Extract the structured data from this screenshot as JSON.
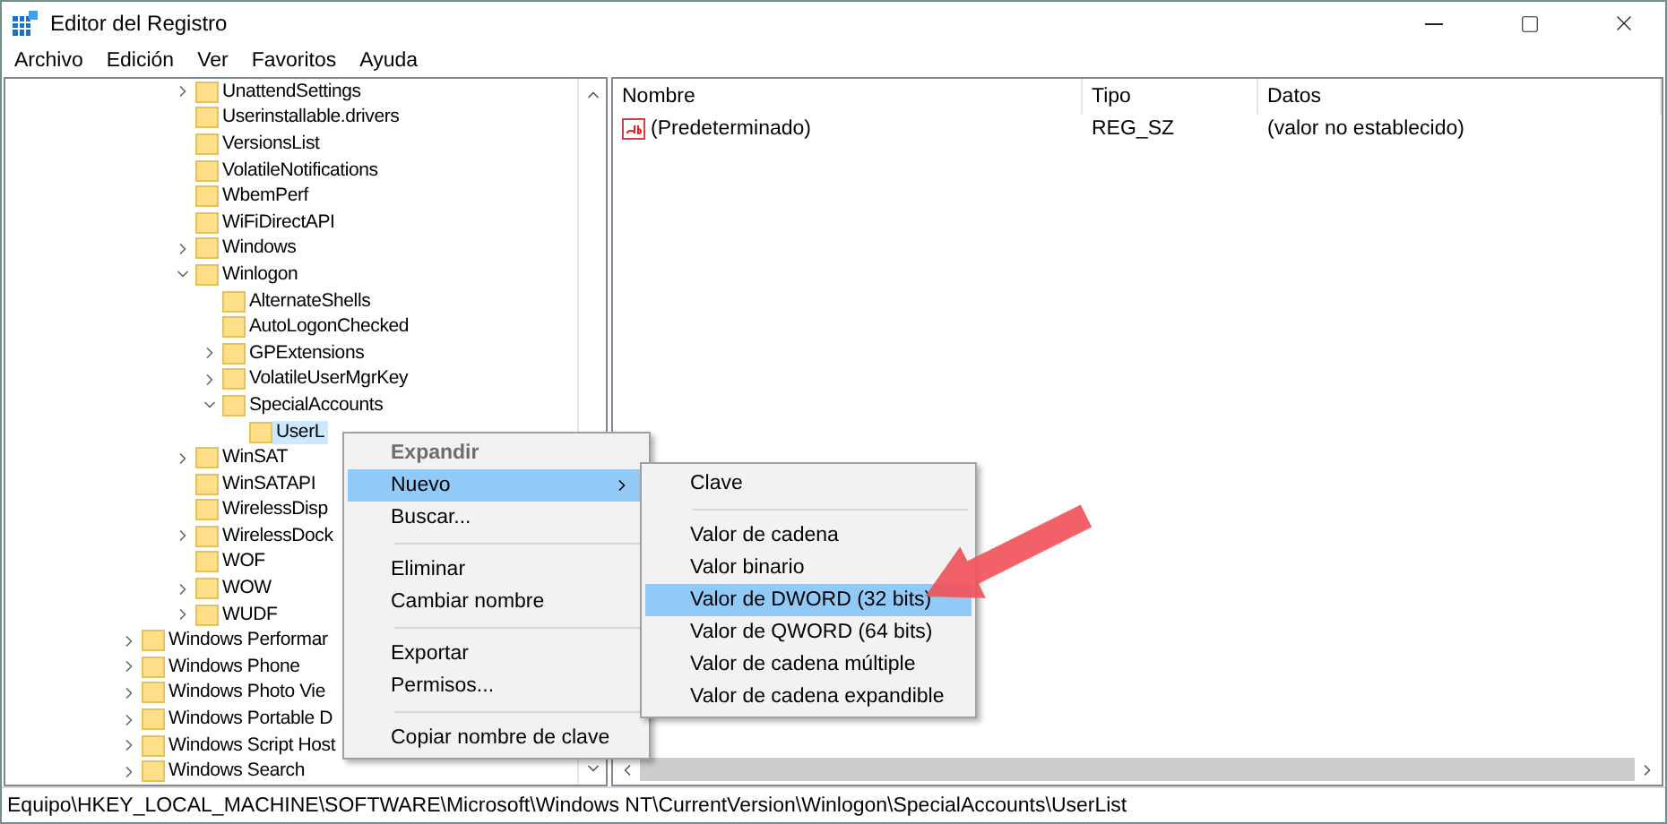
{
  "window": {
    "title": "Editor del Registro"
  },
  "menu_bar": [
    "Archivo",
    "Edición",
    "Ver",
    "Favoritos",
    "Ayuda"
  ],
  "tree": {
    "items": [
      {
        "children": [
          {
            "label": "UnattendSettings",
            "expanded": false,
            "selected": false
          },
          {
            "label": "Userinstallable.drivers",
            "selected": false
          },
          {
            "label": "VersionsList",
            "selected": false
          },
          {
            "label": "VolatileNotifications",
            "selected": false
          },
          {
            "label": "WbemPerf",
            "selected": false
          },
          {
            "label": "WiFiDirectAPI",
            "selected": false
          },
          {
            "label": "Windows",
            "expanded": false,
            "selected": false
          },
          {
            "label": "Winlogon",
            "expanded": true,
            "selected": false,
            "children": [
              {
                "label": "AlternateShells",
                "selected": false
              },
              {
                "label": "AutoLogonChecked",
                "selected": false
              },
              {
                "label": "GPExtensions",
                "expanded": false,
                "selected": false
              },
              {
                "label": "VolatileUserMgrKey",
                "expanded": false,
                "selected": false
              },
              {
                "label": "SpecialAccounts",
                "expanded": true,
                "selected": false,
                "children": [
                  {
                    "label": "UserL",
                    "selected": true
                  }
                ]
              }
            ]
          },
          {
            "label": "WinSAT",
            "expanded": false,
            "selected": false
          },
          {
            "label": "WinSATAPI",
            "selected": false
          },
          {
            "label": "WirelessDisp",
            "selected": false
          },
          {
            "label": "WirelessDock",
            "expanded": false,
            "selected": false
          },
          {
            "label": "WOF",
            "selected": false
          },
          {
            "label": "WOW",
            "expanded": false,
            "selected": false
          },
          {
            "label": "WUDF",
            "expanded": false,
            "selected": false
          }
        ]
      },
      {
        "label": "Windows Performar",
        "expanded": false,
        "selected": false
      },
      {
        "label": "Windows Phone",
        "expanded": false,
        "selected": false
      },
      {
        "label": "Windows Photo Vie",
        "expanded": false,
        "selected": false
      },
      {
        "label": "Windows Portable D",
        "expanded": false,
        "selected": false
      },
      {
        "label": "Windows Script Host",
        "expanded": false,
        "selected": false
      },
      {
        "label": "Windows Search",
        "expanded": false,
        "selected": false
      }
    ]
  },
  "values_list": {
    "columns": [
      "Nombre",
      "Tipo",
      "Datos"
    ],
    "rows": [
      {
        "name": "(Predeterminado)",
        "type": "REG_SZ",
        "data": "(valor no establecido)"
      }
    ]
  },
  "context_menu": {
    "items": [
      {
        "kind": "item",
        "label": "Expandir",
        "disabled": true,
        "selected": false
      },
      {
        "kind": "item",
        "label": "Nuevo",
        "submenu": true,
        "selected": true
      },
      {
        "kind": "item",
        "label": "Buscar...",
        "selected": false
      },
      {
        "kind": "separator"
      },
      {
        "kind": "item",
        "label": "Eliminar",
        "selected": false
      },
      {
        "kind": "item",
        "label": "Cambiar nombre",
        "selected": false
      },
      {
        "kind": "separator"
      },
      {
        "kind": "item",
        "label": "Exportar",
        "selected": false
      },
      {
        "kind": "item",
        "label": "Permisos...",
        "selected": false
      },
      {
        "kind": "separator"
      },
      {
        "kind": "item",
        "label": "Copiar nombre de clave",
        "selected": false
      }
    ]
  },
  "submenu": {
    "items": [
      {
        "kind": "item",
        "label": "Clave",
        "selected": false
      },
      {
        "kind": "separator"
      },
      {
        "kind": "item",
        "label": "Valor de cadena",
        "selected": false
      },
      {
        "kind": "item",
        "label": "Valor binario",
        "selected": false
      },
      {
        "kind": "item",
        "label": "Valor de DWORD (32 bits)",
        "selected": true
      },
      {
        "kind": "item",
        "label": "Valor de QWORD (64 bits)",
        "selected": false
      },
      {
        "kind": "item",
        "label": "Valor de cadena múltiple",
        "selected": false
      },
      {
        "kind": "item",
        "label": "Valor de cadena expandible",
        "selected": false
      }
    ]
  },
  "status_bar": "Equipo\\HKEY_LOCAL_MACHINE\\SOFTWARE\\Microsoft\\Windows NT\\CurrentVersion\\Winlogon\\SpecialAccounts\\UserList"
}
